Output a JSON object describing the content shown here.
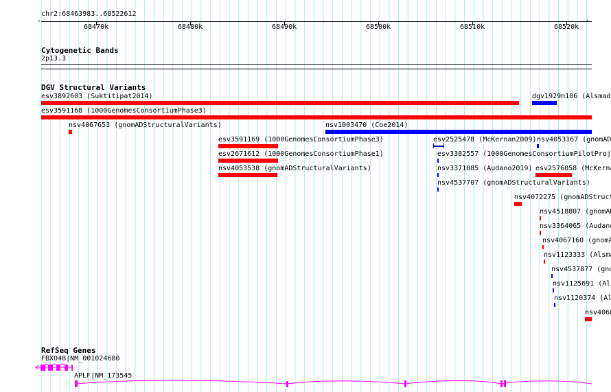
{
  "colors": {
    "red": "#ff0000",
    "blue": "#0000ff",
    "magenta": "#ff00ff",
    "grid": "#b8e6f0"
  },
  "ruler": {
    "coord_label": "chr2:68463983..68522612",
    "ticks": [
      "68470k",
      "68480k",
      "68490k",
      "68500k",
      "68510k",
      "68520k"
    ]
  },
  "cytoband": {
    "title": "Cytogenetic Bands",
    "band_label": "2p13.3"
  },
  "dgv": {
    "title": "DGV Structural Variants",
    "features": [
      {
        "label": "esv3892603 (Suktitipat2014)",
        "color": "red"
      },
      {
        "label": "dgv1929n106 (Alsmadi",
        "color": "blue"
      },
      {
        "label": "esv3591168 (1000GenomesConsortiumPhase3)",
        "color": "red"
      },
      {
        "label": "nsv4067653 (gnomADStructuralVariants)",
        "color": "red"
      },
      {
        "label": "nsv1003470 (Coe2014)",
        "color": "blue"
      },
      {
        "label": "esv3591169 (1000GenomesConsortiumPhase3)",
        "color": "red"
      },
      {
        "label": "esv2525478 (McKernan2009)",
        "color": "blue"
      },
      {
        "label": "nsv4053167 (gnomAD",
        "color": "blue"
      },
      {
        "label": "esv2671612 (1000GenomesConsortiumPhase1)",
        "color": "red"
      },
      {
        "label": "esv3382557 (1000GenomesConsortiumPilotProje",
        "color": "blue"
      },
      {
        "label": "nsv4053538 (gnomADStructuralVariants)",
        "color": "red"
      },
      {
        "label": "nsv3371085 (Audano2019)",
        "color": "blue"
      },
      {
        "label": "esv2576058 (McKerna",
        "color": "red"
      },
      {
        "label": "nsv4537707 (gnomADStructuralVariants)",
        "color": "blue"
      },
      {
        "label": "nsv4072275 (gnomADStruct",
        "color": "red"
      },
      {
        "label": "nsv4518807 (gnomAD",
        "color": "red"
      },
      {
        "label": "nsv3364065 (Audano",
        "color": "red"
      },
      {
        "label": "nsv4067160 (gnomA",
        "color": "red"
      },
      {
        "label": "nsv1123333 (Alsma",
        "color": "red"
      },
      {
        "label": "nsv4537877 (gno",
        "color": "blue"
      },
      {
        "label": "nsv1125691 (Al",
        "color": "blue"
      },
      {
        "label": "nsv1120374 (Al",
        "color": "blue"
      },
      {
        "label": "nsv4068",
        "color": "red"
      }
    ]
  },
  "refseq": {
    "title": "RefSeq Genes",
    "genes": [
      {
        "label": "FBXO48|NM_001024680",
        "color": "magenta"
      },
      {
        "label": "APLF|NM_173545",
        "color": "magenta"
      }
    ]
  }
}
